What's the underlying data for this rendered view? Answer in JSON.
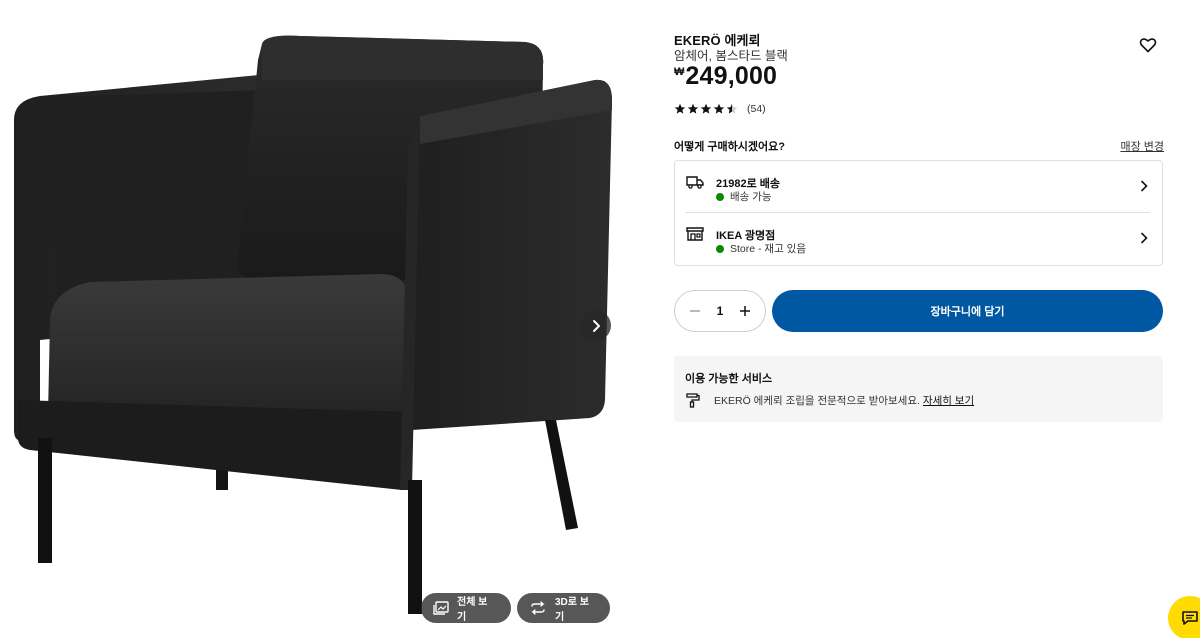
{
  "gallery": {
    "full_view_label": "전체 보기",
    "view_3d_label": "3D로 보기"
  },
  "product": {
    "name": "EKERÖ 에케뢰",
    "description": "암체어, 봄스타드 블랙",
    "currency": "₩",
    "price": "249,000",
    "rating_stars": 4.5,
    "review_count": "(54)"
  },
  "purchase": {
    "question": "어떻게 구매하시겠어요?",
    "change_store": "매장 변경",
    "options": [
      {
        "title": "21982로 배송",
        "status": "배송 가능",
        "icon": "truck-icon"
      },
      {
        "title": "IKEA 광명점",
        "status": "Store - 재고 있음",
        "icon": "store-icon"
      }
    ],
    "status_color": "#0a8a00"
  },
  "cart": {
    "quantity": "1",
    "add_to_cart": "장바구니에 담기",
    "button_color": "#0058a3"
  },
  "services": {
    "title": "이용 가능한 서비스",
    "line": "EKERÖ 에케뢰 조립을 전문적으로 받아보세요.",
    "link": "자세히 보기"
  },
  "chat_color": "#ffdb00"
}
